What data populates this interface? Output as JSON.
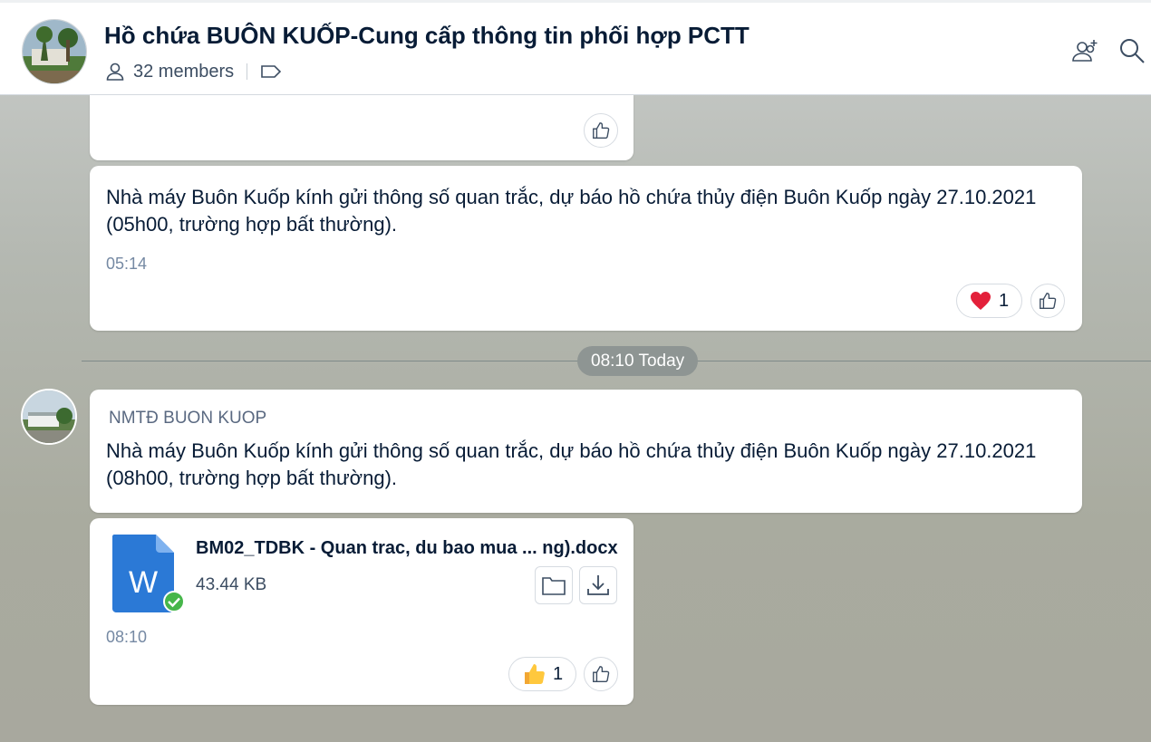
{
  "header": {
    "title": "Hồ chứa BUÔN KUỐP-Cung cấp thông tin phối hợp PCTT",
    "members_label": "32 members",
    "icons": [
      "person-icon",
      "tag-icon",
      "add-member-icon",
      "search-icon"
    ]
  },
  "messages": [
    {
      "reactions": []
    },
    {
      "text_line1": "Nhà máy Buôn Kuốp kính gửi thông số quan trắc, dự báo hồ chứa thủy điện Buôn Kuốp ngày 27.10.2021",
      "text_line2": "(05h00, trường hợp bất thường).",
      "time": "05:14",
      "reaction_count": "1",
      "reaction_icon": "heart-icon"
    },
    {
      "sender": "NMTĐ BUON KUOP",
      "text_line1": "Nhà máy Buôn Kuốp kính gửi thông số quan trắc, dự báo hồ chứa thủy điện Buôn Kuốp ngày 27.10.2021",
      "text_line2": "(08h00, trường hợp bất thường)."
    },
    {
      "file_name": "BM02_TDBK - Quan trac, du bao mua ... ng).docx",
      "file_size": "43.44 KB",
      "file_icon_letter": "W",
      "time": "08:10",
      "reaction_count": "1",
      "reaction_icon": "thumbs-up-icon"
    }
  ],
  "divider": {
    "label": "08:10 Today"
  },
  "colors": {
    "accent_blue": "#2b79d6",
    "heart_red": "#e3203a",
    "check_green": "#46b64a"
  }
}
